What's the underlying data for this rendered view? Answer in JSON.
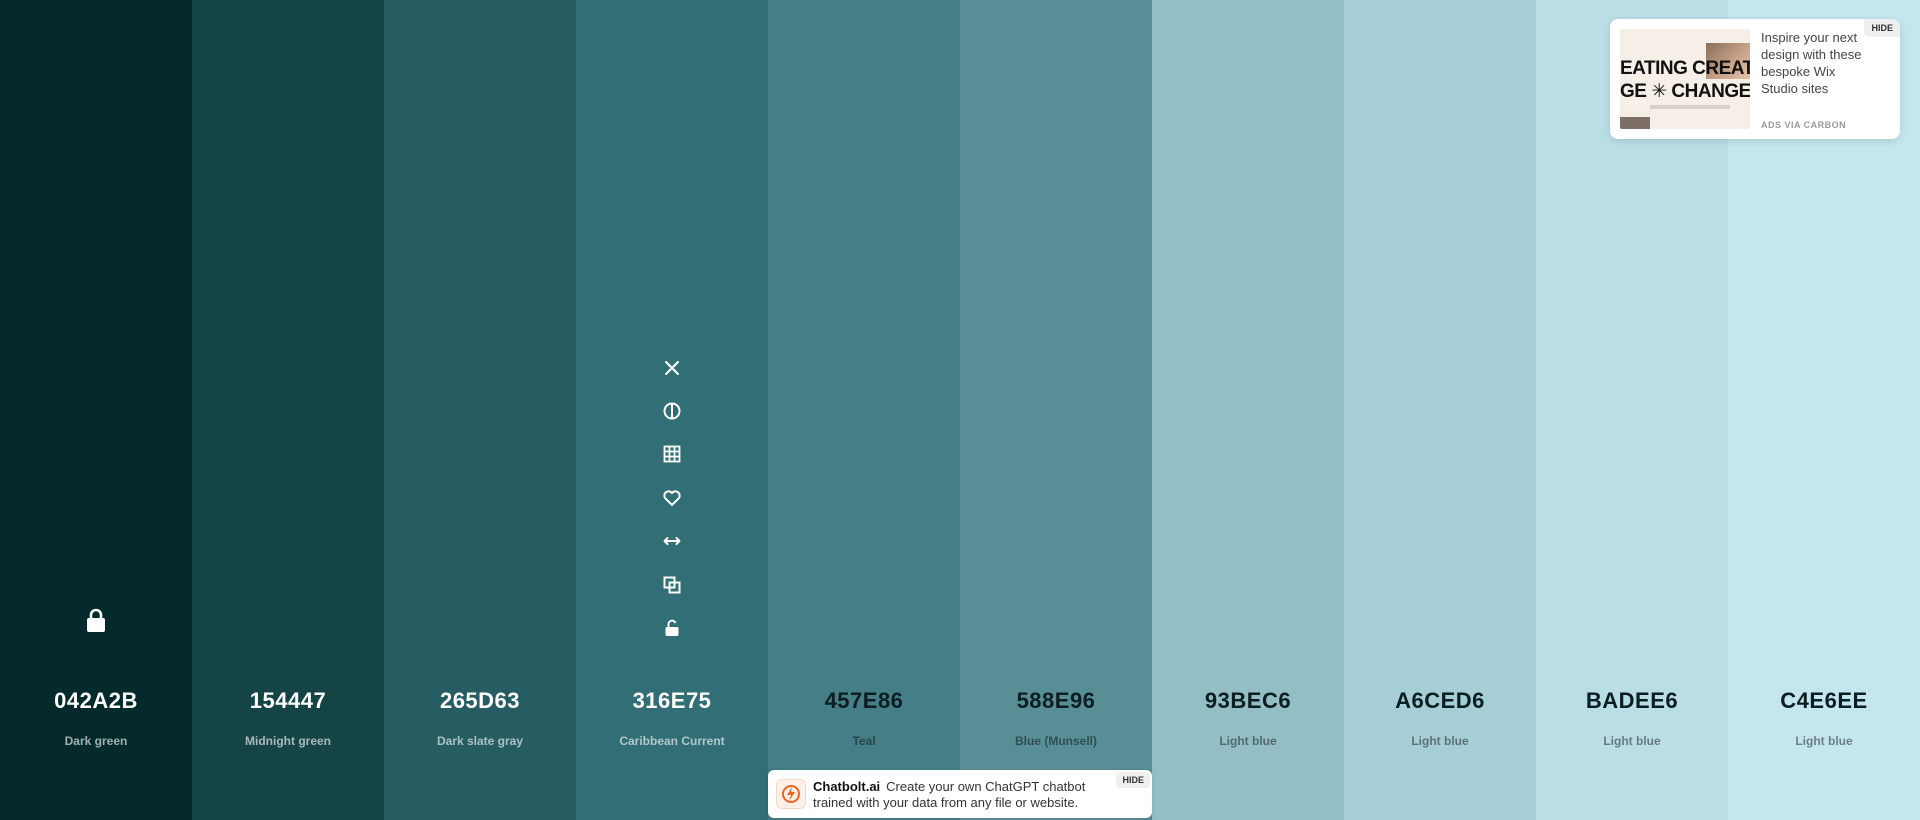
{
  "swatches": [
    {
      "hex": "042A2B",
      "name": "Dark green",
      "color": "#042A2B",
      "tone": "dark"
    },
    {
      "hex": "154447",
      "name": "Midnight green",
      "color": "#154447",
      "tone": "dark"
    },
    {
      "hex": "265D63",
      "name": "Dark slate gray",
      "color": "#265D63",
      "tone": "dark"
    },
    {
      "hex": "316E75",
      "name": "Caribbean Current",
      "color": "#316E75",
      "tone": "dark"
    },
    {
      "hex": "457E86",
      "name": "Teal",
      "color": "#457E86",
      "tone": "light"
    },
    {
      "hex": "588E96",
      "name": "Blue (Munsell)",
      "color": "#588E96",
      "tone": "light"
    },
    {
      "hex": "93BEC6",
      "name": "Light blue",
      "color": "#93BEC6",
      "tone": "light"
    },
    {
      "hex": "A6CED6",
      "name": "Light blue",
      "color": "#A6CED6",
      "tone": "light"
    },
    {
      "hex": "BADEE6",
      "name": "Light blue",
      "color": "#BADEE6",
      "tone": "light"
    },
    {
      "hex": "C4E6EE",
      "name": "Light blue",
      "color": "#C4E6EE",
      "tone": "light"
    }
  ],
  "locked_swatch_index": 0,
  "active_swatch_index": 3,
  "toolbar_icons": [
    "close-icon",
    "contrast-icon",
    "shades-grid-icon",
    "heart-icon",
    "drag-arrows-icon",
    "copy-icon",
    "unlock-icon"
  ],
  "ad": {
    "image_text_line1": "EATING CREAT",
    "image_text_line2": "GE ✳ CHANGE",
    "text": "Inspire your next design with these bespoke Wix Studio sites",
    "via": "ADS VIA CARBON",
    "hide_label": "HIDE"
  },
  "banner": {
    "brand": "Chatbolt.ai",
    "text": "Create your own ChatGPT chatbot trained with your data from any file or website.",
    "hide_label": "HIDE",
    "logo_color": "#F26322"
  }
}
